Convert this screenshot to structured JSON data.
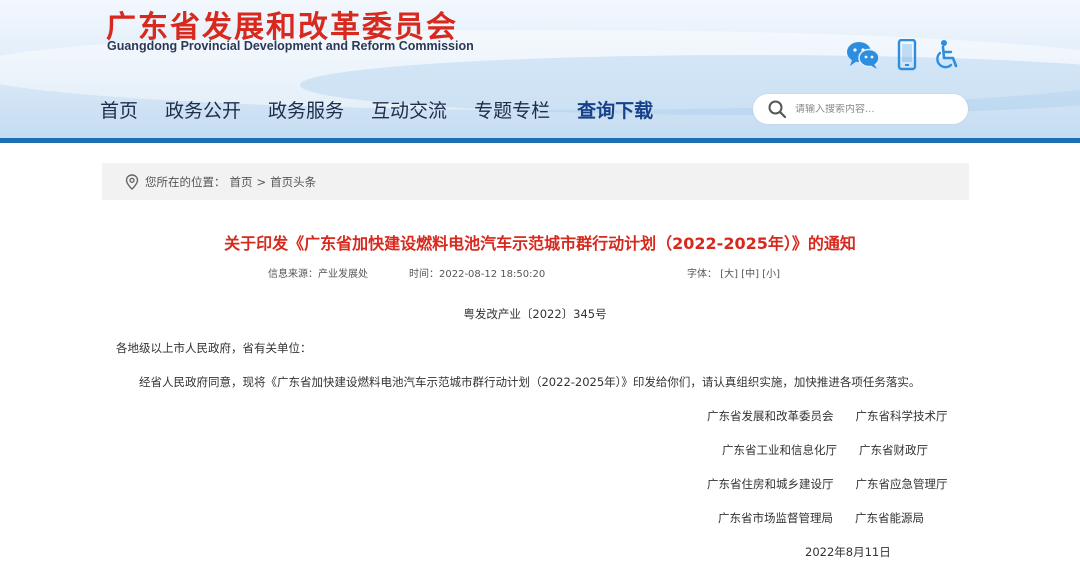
{
  "header": {
    "logo_cn": "广东省发展和改革委员会",
    "logo_en": "Guangdong Provincial Development and Reform Commission",
    "icons": [
      "wechat-icon",
      "mobile-icon",
      "accessibility-icon"
    ]
  },
  "nav": {
    "items": [
      {
        "label": "首页"
      },
      {
        "label": "政务公开"
      },
      {
        "label": "政务服务"
      },
      {
        "label": "互动交流"
      },
      {
        "label": "专题专栏"
      },
      {
        "label": "查询下载"
      }
    ],
    "active_index": 5
  },
  "search": {
    "placeholder": "请输入搜索内容..."
  },
  "breadcrumb": {
    "prefix": "您所在的位置：",
    "items": [
      "首页",
      "首页头条"
    ],
    "separator": ">"
  },
  "article": {
    "title": "关于印发《广东省加快建设燃料电池汽车示范城市群行动计划（2022-2025年）》的通知",
    "source": "信息来源：产业发展处",
    "time": "时间：2022-08-12 18:50:20",
    "font_label": "字体：",
    "font_sizes": [
      "[大]",
      "[中]",
      "[小]"
    ],
    "doc_number": "粤发改产业〔2022〕345号",
    "salutation": "各地级以上市人民政府，省有关单位：",
    "body": "经省人民政府同意，现将《广东省加快建设燃料电池汽车示范城市群行动计划（2022-2025年）》印发给你们，请认真组织实施，加快推进各项任务落实。",
    "signatories": [
      [
        "广东省发展和改革委员会",
        "广东省科学技术厅"
      ],
      [
        "广东省工业和信息化厅",
        "广东省财政厅"
      ],
      [
        "广东省住房和城乡建设厅",
        "广东省应急管理厅"
      ],
      [
        "广东省市场监督管理局",
        "广东省能源局"
      ]
    ],
    "date": "2022年8月11日"
  },
  "colors": {
    "brand_red": "#d7291e",
    "nav_active": "#17428a",
    "header_line": "#1f6fb3",
    "icon_blue": "#2d8ee0"
  }
}
